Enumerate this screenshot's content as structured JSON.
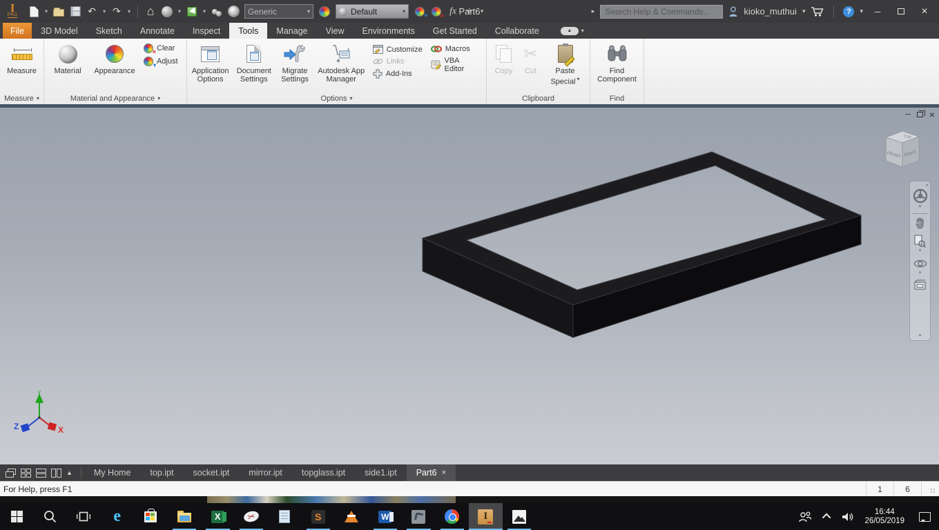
{
  "titlebar": {
    "logo_badge": "PRO",
    "material_style_value": "Generic",
    "appearance_style_value": "Default",
    "fx_label": "fx",
    "document_title": "Part6",
    "search_placeholder": "Search Help & Commands...",
    "username": "kioko_muthui"
  },
  "ribbon_tabs": [
    {
      "label": "File"
    },
    {
      "label": "3D Model"
    },
    {
      "label": "Sketch"
    },
    {
      "label": "Annotate"
    },
    {
      "label": "Inspect"
    },
    {
      "label": "Tools"
    },
    {
      "label": "Manage"
    },
    {
      "label": "View"
    },
    {
      "label": "Environments"
    },
    {
      "label": "Get Started"
    },
    {
      "label": "Collaborate"
    }
  ],
  "ribbon": {
    "buttons": {
      "measure": "Measure",
      "material": "Material",
      "appearance": "Appearance",
      "clear": "Clear",
      "adjust": "Adjust",
      "application_options": "Application Options",
      "document_settings": "Document Settings",
      "migrate_settings": "Migrate Settings",
      "app_manager": "Autodesk App Manager",
      "customize": "Customize",
      "links": "Links",
      "add_ins": "Add-Ins",
      "macros": "Macros",
      "vba_editor": "VBA Editor",
      "copy": "Copy",
      "cut": "Cut",
      "paste_special": "Paste Special",
      "find_component": "Find Component"
    },
    "sections": {
      "measure": "Measure",
      "material_appearance": "Material and Appearance",
      "options": "Options",
      "clipboard": "Clipboard",
      "find": "Find"
    }
  },
  "viewport": {
    "viewcube": {
      "top": "TOP",
      "front": "FRONT",
      "right": "RIGHT"
    },
    "axes": {
      "x": "X",
      "y": "Y",
      "z": "Z"
    }
  },
  "doc_tabs": [
    {
      "label": "My Home"
    },
    {
      "label": "top.ipt"
    },
    {
      "label": "socket.ipt"
    },
    {
      "label": "mirror.ipt"
    },
    {
      "label": "topglass.ipt"
    },
    {
      "label": "side1.ipt"
    },
    {
      "label": "Part6"
    }
  ],
  "statusbar": {
    "help_text": "For Help, press F1",
    "field1": "1",
    "field2": "6"
  },
  "taskbar": {
    "time": "16:44",
    "date": "26/05/2019",
    "glyphs": {
      "edge": "e",
      "excel": "X",
      "word": "W",
      "sublime": "S",
      "inventor": "I"
    }
  },
  "icons": {
    "caret_down": "▾",
    "caret_up": "▲",
    "arrow_right": "▸",
    "close": "×",
    "minimize": "─",
    "undo": "↶",
    "redo": "↷",
    "home": "⌂",
    "plus": "+",
    "help": "?",
    "scissors": "✂"
  }
}
